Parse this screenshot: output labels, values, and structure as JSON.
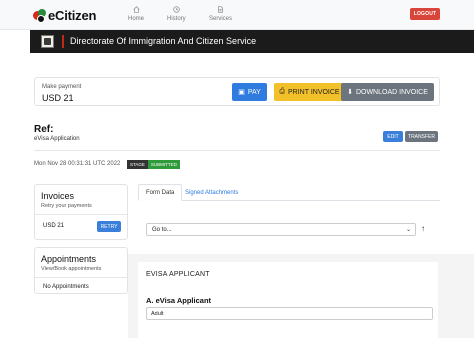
{
  "navbar": {
    "logo_text": "eCitizen",
    "items": [
      {
        "label": "Home",
        "icon": "home-icon"
      },
      {
        "label": "History",
        "icon": "history-icon"
      },
      {
        "label": "Services",
        "icon": "services-icon"
      }
    ],
    "logout_label": "LOGOUT"
  },
  "banner": {
    "title": "Directorate Of Immigration And Citizen Service"
  },
  "payment": {
    "label": "Make payment",
    "amount": "USD 21",
    "pay_label": "PAY",
    "print_label": "PRINT INVOICE",
    "download_label": "DOWNLOAD INVOICE"
  },
  "ref": {
    "title": "Ref:",
    "subtitle": "eVisa Application",
    "edit_label": "EDIT",
    "transfer_label": "TRANSFER",
    "date": "Mon Nov 28 00:31:31 UTC 2022",
    "stage_label": "STAGE",
    "stage_value": "SUBMITTED"
  },
  "invoices": {
    "title": "Invoices",
    "subtitle": "Retry your payments",
    "amount": "USD 21",
    "retry_label": "RETRY"
  },
  "appointments": {
    "title": "Appointments",
    "subtitle": "View/Book appointments",
    "empty_text": "No Appointments"
  },
  "tabs": [
    {
      "label": "Form Data"
    },
    {
      "label": "Signed Attachments"
    }
  ],
  "goto": {
    "value": "Go to..."
  },
  "form": {
    "section_title": "EVISA APPLICANT",
    "field_label": "A. eVisa Applicant",
    "field_value": "Adult"
  },
  "colors": {
    "primary": "#2f7be0",
    "warning": "#f2c028",
    "secondary": "#6c757d",
    "danger": "#d9453b",
    "success": "#2f9a3a",
    "banner": "#1b1b1b"
  }
}
